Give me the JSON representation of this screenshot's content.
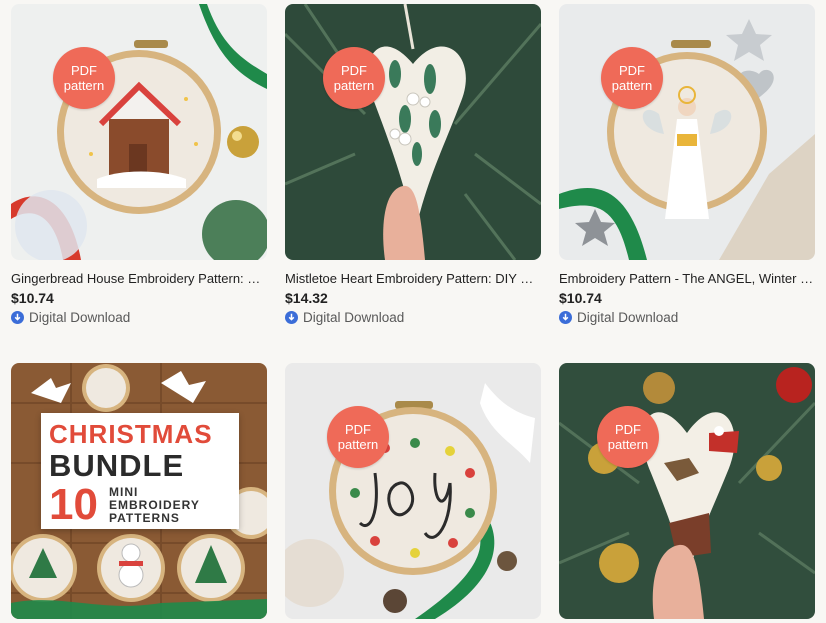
{
  "theme": {
    "background": "#f8f7f4",
    "badge_color": "#ef6a58",
    "download_icon_color": "#3b6dd8",
    "bundle_red": "#e14b3a"
  },
  "listings": [
    {
      "badge": [
        "PDF",
        "pattern"
      ],
      "title": "Gingerbread House Embroidery Pattern: DIY Christmas Ornament",
      "price": "$10.74",
      "delivery": "Digital Download",
      "delivery_icon": "download-cloud-icon",
      "image": "gingerbread-house-embroidery-hoop"
    },
    {
      "badge": [
        "PDF",
        "pattern"
      ],
      "title": "Mistletoe Heart Embroidery Pattern: DIY Christmas Ornament",
      "price": "$14.32",
      "delivery": "Digital Download",
      "delivery_icon": "download-cloud-icon",
      "image": "mistletoe-heart-ornament"
    },
    {
      "badge": [
        "PDF",
        "pattern"
      ],
      "title": "Embroidery Pattern - The ANGEL, Winter Hoop Art",
      "price": "$10.74",
      "delivery": "Digital Download",
      "delivery_icon": "download-cloud-icon",
      "image": "angel-embroidery-hoop"
    },
    {
      "bundle_text": {
        "line1": "CHRISTMAS",
        "line2": "BUNDLE",
        "number": "10",
        "sub": "MINI\nEMBROIDERY\nPATTERNS"
      },
      "image": "christmas-bundle-hoops"
    },
    {
      "badge": [
        "PDF",
        "pattern"
      ],
      "image": "joy-lettering-embroidery-hoop"
    },
    {
      "badge": [
        "PDF",
        "pattern"
      ],
      "image": "santa-sleigh-heart-ornament"
    }
  ]
}
